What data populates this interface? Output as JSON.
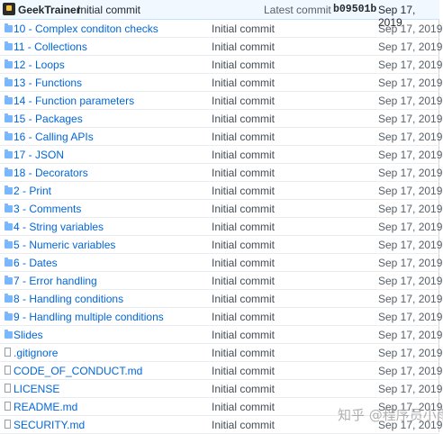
{
  "header": {
    "author": "GeekTrainer",
    "message": "Initial commit",
    "latest_label": "Latest commit",
    "sha": "b09501b",
    "date": "Sep 17, 2019"
  },
  "rows": [
    {
      "name": "10 - Complex conditon checks",
      "type": "folder",
      "message": "Initial commit",
      "date": "Sep 17, 2019"
    },
    {
      "name": "11 - Collections",
      "type": "folder",
      "message": "Initial commit",
      "date": "Sep 17, 2019"
    },
    {
      "name": "12 - Loops",
      "type": "folder",
      "message": "Initial commit",
      "date": "Sep 17, 2019"
    },
    {
      "name": "13 - Functions",
      "type": "folder",
      "message": "Initial commit",
      "date": "Sep 17, 2019"
    },
    {
      "name": "14 - Function parameters",
      "type": "folder",
      "message": "Initial commit",
      "date": "Sep 17, 2019"
    },
    {
      "name": "15 - Packages",
      "type": "folder",
      "message": "Initial commit",
      "date": "Sep 17, 2019"
    },
    {
      "name": "16 - Calling APIs",
      "type": "folder",
      "message": "Initial commit",
      "date": "Sep 17, 2019"
    },
    {
      "name": "17 - JSON",
      "type": "folder",
      "message": "Initial commit",
      "date": "Sep 17, 2019"
    },
    {
      "name": "18 - Decorators",
      "type": "folder",
      "message": "Initial commit",
      "date": "Sep 17, 2019"
    },
    {
      "name": "2 - Print",
      "type": "folder",
      "message": "Initial commit",
      "date": "Sep 17, 2019"
    },
    {
      "name": "3 - Comments",
      "type": "folder",
      "message": "Initial commit",
      "date": "Sep 17, 2019"
    },
    {
      "name": "4 - String variables",
      "type": "folder",
      "message": "Initial commit",
      "date": "Sep 17, 2019"
    },
    {
      "name": "5 - Numeric variables",
      "type": "folder",
      "message": "Initial commit",
      "date": "Sep 17, 2019"
    },
    {
      "name": "6 - Dates",
      "type": "folder",
      "message": "Initial commit",
      "date": "Sep 17, 2019"
    },
    {
      "name": "7 - Error handling",
      "type": "folder",
      "message": "Initial commit",
      "date": "Sep 17, 2019"
    },
    {
      "name": "8 - Handling conditions",
      "type": "folder",
      "message": "Initial commit",
      "date": "Sep 17, 2019"
    },
    {
      "name": "9 - Handling multiple conditions",
      "type": "folder",
      "message": "Initial commit",
      "date": "Sep 17, 2019"
    },
    {
      "name": "Slides",
      "type": "folder",
      "message": "Initial commit",
      "date": "Sep 17, 2019"
    },
    {
      "name": ".gitignore",
      "type": "file",
      "message": "Initial commit",
      "date": "Sep 17, 2019"
    },
    {
      "name": "CODE_OF_CONDUCT.md",
      "type": "file",
      "message": "Initial commit",
      "date": "Sep 17, 2019"
    },
    {
      "name": "LICENSE",
      "type": "file",
      "message": "Initial commit",
      "date": "Sep 17, 2019"
    },
    {
      "name": "README.md",
      "type": "file",
      "message": "Initial commit",
      "date": "Sep 17, 2019"
    },
    {
      "name": "SECURITY.md",
      "type": "file",
      "message": "Initial commit",
      "date": "Sep 17, 2019"
    }
  ],
  "watermark": "知乎 @程序员小雨"
}
